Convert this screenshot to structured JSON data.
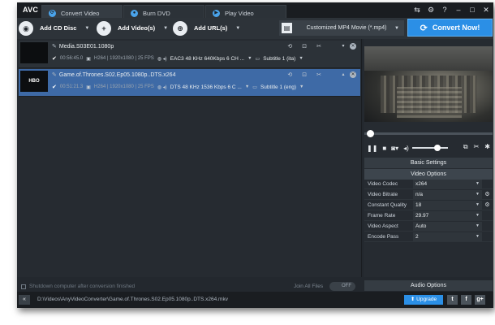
{
  "app": {
    "logo": "AVC"
  },
  "tabs": [
    {
      "label": "Convert Video",
      "icon": "refresh-icon",
      "color": "#4aa3ea"
    },
    {
      "label": "Burn DVD",
      "icon": "disc-icon",
      "color": "#4aa3ea"
    },
    {
      "label": "Play Video",
      "icon": "play-icon",
      "color": "#4aa3ea"
    }
  ],
  "window_controls": [
    "⇆",
    "⚙",
    "?",
    "–",
    "□",
    "✕"
  ],
  "toolbar": {
    "add_cd_disc": "Add CD Disc",
    "add_videos": "Add Video(s)",
    "add_url": "Add URL(s)",
    "profile": "Customized MP4 Movie (*.mp4)",
    "convert": "Convert Now!"
  },
  "files": [
    {
      "name": "Media.S03E01.1080p",
      "thumb": "",
      "duration": "00:56:45.0",
      "video_info": "H264 | 1920x1080 | 25 FPS",
      "audio": "EAC3 48 KHz 640Kbps 6 CH ...",
      "subtitle": "Subtitle 1 (ita)"
    },
    {
      "name": "Game.of.Thrones.S02.Ep05.1080p..DTS.x264",
      "thumb": "HBO",
      "duration": "00:51:21.3",
      "video_info": "H264 | 1920x1080 | 25 FPS",
      "audio": "DTS 48 KHz 1536 Kbps 6 C ...",
      "subtitle": "Subtitle 1 (eng)"
    }
  ],
  "bottom": {
    "shutdown": "Shutdown computer after conversion finished",
    "join_all": "Join All Files",
    "toggle": "OFF"
  },
  "player": {
    "progress": 0.02,
    "volume": 0.7
  },
  "sections": {
    "basic": "Basic Settings",
    "video": "Video Options",
    "audio": "Audio Options"
  },
  "settings": [
    {
      "label": "Video Codec",
      "value": "x264",
      "gear": false
    },
    {
      "label": "Video Bitrate",
      "value": "n/a",
      "gear": true
    },
    {
      "label": "Constant Quality",
      "value": "18",
      "gear": true
    },
    {
      "label": "Frame Rate",
      "value": "29.97",
      "gear": false
    },
    {
      "label": "Video Aspect",
      "value": "Auto",
      "gear": false
    },
    {
      "label": "Encode Pass",
      "value": "2",
      "gear": false
    }
  ],
  "status": {
    "path": "D:\\Videos\\AnyVideoConverter\\Game.of.Thrones.S02.Ep05.1080p..DTS.x264.mkv",
    "upgrade": "Upgrade",
    "social": [
      "t",
      "f",
      "g+"
    ]
  }
}
